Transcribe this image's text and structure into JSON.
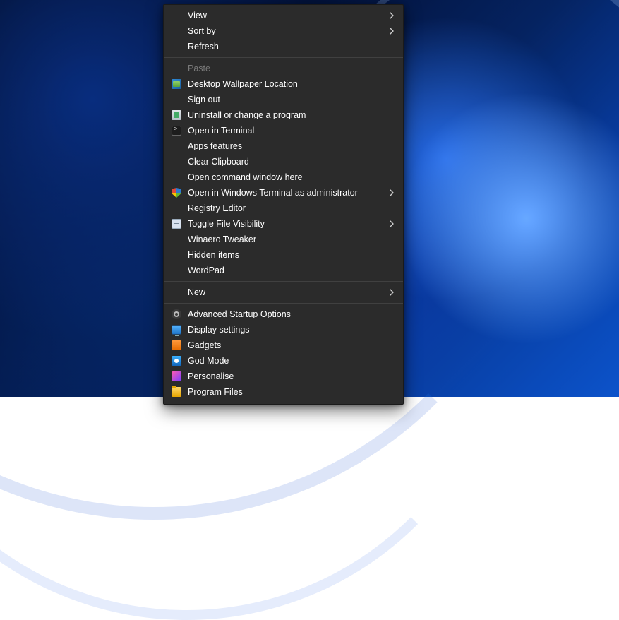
{
  "menu": {
    "groups": [
      [
        {
          "id": "view",
          "label": "View",
          "icon": null,
          "submenu": true,
          "disabled": false
        },
        {
          "id": "sort-by",
          "label": "Sort by",
          "icon": null,
          "submenu": true,
          "disabled": false
        },
        {
          "id": "refresh",
          "label": "Refresh",
          "icon": null,
          "submenu": false,
          "disabled": false
        }
      ],
      [
        {
          "id": "paste",
          "label": "Paste",
          "icon": null,
          "submenu": false,
          "disabled": true
        },
        {
          "id": "desktop-wallpaper-location",
          "label": "Desktop Wallpaper Location",
          "icon": "img",
          "submenu": false,
          "disabled": false
        },
        {
          "id": "sign-out",
          "label": "Sign out",
          "icon": null,
          "submenu": false,
          "disabled": false
        },
        {
          "id": "uninstall-change-program",
          "label": "Uninstall or change a program",
          "icon": "uninstall",
          "submenu": false,
          "disabled": false
        },
        {
          "id": "open-in-terminal",
          "label": "Open in Terminal",
          "icon": "terminal",
          "submenu": false,
          "disabled": false
        },
        {
          "id": "apps-features",
          "label": "Apps  features",
          "icon": null,
          "submenu": false,
          "disabled": false
        },
        {
          "id": "clear-clipboard",
          "label": "Clear Clipboard",
          "icon": null,
          "submenu": false,
          "disabled": false
        },
        {
          "id": "open-command-window-here",
          "label": "Open command window here",
          "icon": null,
          "submenu": false,
          "disabled": false
        },
        {
          "id": "open-windows-terminal-admin",
          "label": "Open in Windows Terminal as administrator",
          "icon": "shield",
          "submenu": true,
          "disabled": false
        },
        {
          "id": "registry-editor",
          "label": "Registry Editor",
          "icon": null,
          "submenu": false,
          "disabled": false
        },
        {
          "id": "toggle-file-visibility",
          "label": "Toggle File Visibility",
          "icon": "doc",
          "submenu": true,
          "disabled": false
        },
        {
          "id": "winaero-tweaker",
          "label": "Winaero Tweaker",
          "icon": null,
          "submenu": false,
          "disabled": false
        },
        {
          "id": "hidden-items",
          "label": "Hidden items",
          "icon": null,
          "submenu": false,
          "disabled": false
        },
        {
          "id": "wordpad",
          "label": "WordPad",
          "icon": null,
          "submenu": false,
          "disabled": false
        }
      ],
      [
        {
          "id": "new",
          "label": "New",
          "icon": null,
          "submenu": true,
          "disabled": false
        }
      ],
      [
        {
          "id": "advanced-startup-options",
          "label": "Advanced Startup Options",
          "icon": "gear",
          "submenu": false,
          "disabled": false
        },
        {
          "id": "display-settings",
          "label": "Display settings",
          "icon": "monitor",
          "submenu": false,
          "disabled": false
        },
        {
          "id": "gadgets",
          "label": "Gadgets",
          "icon": "gadget",
          "submenu": false,
          "disabled": false
        },
        {
          "id": "god-mode",
          "label": "God Mode",
          "icon": "god",
          "submenu": false,
          "disabled": false
        },
        {
          "id": "personalise",
          "label": "Personalise",
          "icon": "personalise",
          "submenu": false,
          "disabled": false
        },
        {
          "id": "program-files",
          "label": "Program Files",
          "icon": "folder",
          "submenu": false,
          "disabled": false
        }
      ]
    ]
  }
}
